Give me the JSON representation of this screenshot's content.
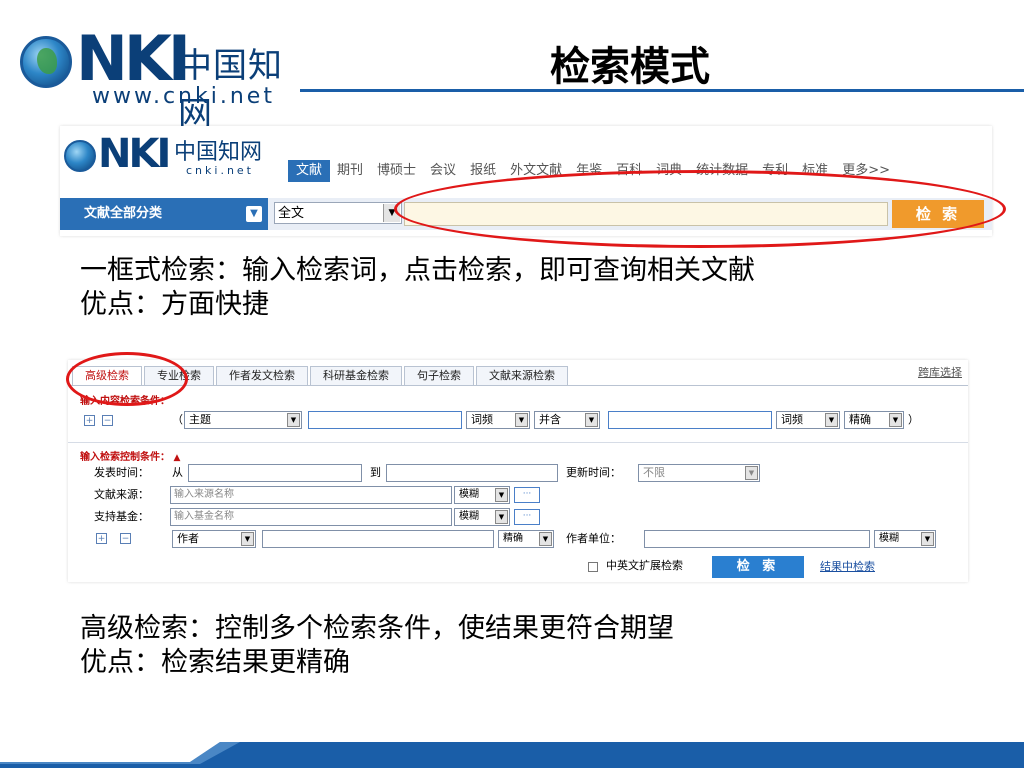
{
  "slide": {
    "title": "检索模式",
    "logo": {
      "brand": "NKI",
      "cn_name": "中国知网",
      "url": "www.cnki.net"
    }
  },
  "panel1": {
    "logo": {
      "brand": "NKI",
      "cn_name": "中国知网",
      "url": "cnki.net"
    },
    "tabs": [
      "文献",
      "期刊",
      "博硕士",
      "会议",
      "报纸",
      "外文文献",
      "年鉴",
      "百科",
      "词典",
      "统计数据",
      "专利",
      "标准",
      "更多>>"
    ],
    "active_tab": 0,
    "category_button": "文献全部分类",
    "field_select": "全文",
    "search_input_value": "",
    "search_button": "检 索"
  },
  "caption1": {
    "line1": "一框式检索：输入检索词，点击检索，即可查询相关文献",
    "line2": "优点：方面快捷"
  },
  "panel2": {
    "tabs": [
      "高级检索",
      "专业检索",
      "作者发文检索",
      "科研基金检索",
      "句子检索",
      "文献来源检索"
    ],
    "active_tab": 0,
    "db_select": "跨库选择",
    "content_section_label": "输入内容检索条件：",
    "row1": {
      "open_paren": "（",
      "field": "主题",
      "freq1": "词频",
      "logic": "并含",
      "freq2": "词频",
      "match": "精确",
      "close_paren": "）"
    },
    "control_section_label": "输入检索控制条件：",
    "publish_time_label": "发表时间：",
    "from_label": "从",
    "to_label": "到",
    "update_time_label": "更新时间：",
    "update_time_value": "不限",
    "source_label": "文献来源：",
    "source_placeholder": "输入来源名称",
    "source_match": "模糊",
    "fund_label": "支持基金：",
    "fund_placeholder": "输入基金名称",
    "fund_match": "模糊",
    "author_field": "作者",
    "author_match": "精确",
    "author_unit_label": "作者单位：",
    "unit_match": "模糊",
    "dots": "···",
    "extend_label": "中英文扩展检索",
    "search_button": "检 索",
    "result_search_link": "结果中检索"
  },
  "caption2": {
    "line1": "高级检索：控制多个检索条件，使结果更符合期望",
    "line2": "优点：检索结果更精确"
  },
  "colors": {
    "brand_blue": "#0b3f78",
    "tab_blue": "#2a6fb6",
    "search_orange": "#f09a2c",
    "highlight_red": "#e01818",
    "band_blue": "#1a5ea8"
  }
}
